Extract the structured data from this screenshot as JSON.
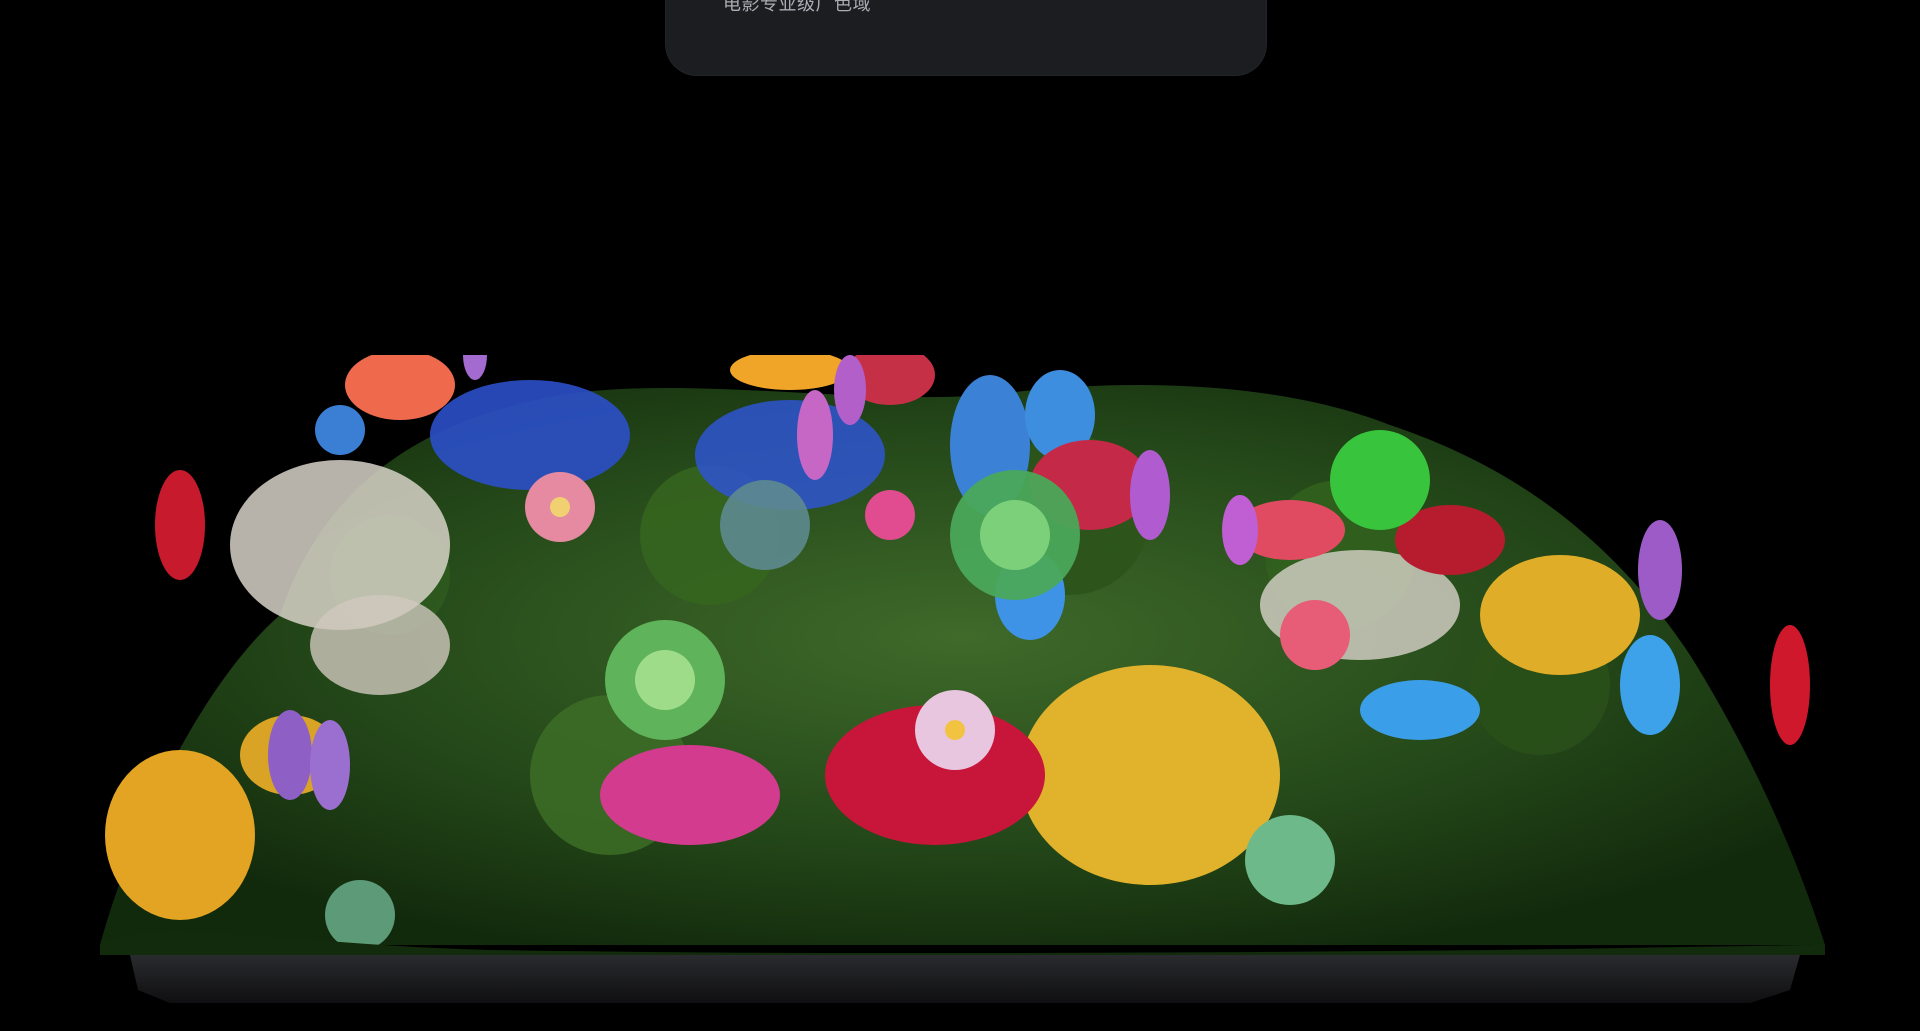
{
  "header": {
    "caption": "电影专业级广色域"
  },
  "hero": {
    "image_icon": "flower-garden-display-illustration",
    "colors": {
      "background": "#000000",
      "card": "#1b1d21",
      "base_plate": "#1c1d20"
    }
  }
}
